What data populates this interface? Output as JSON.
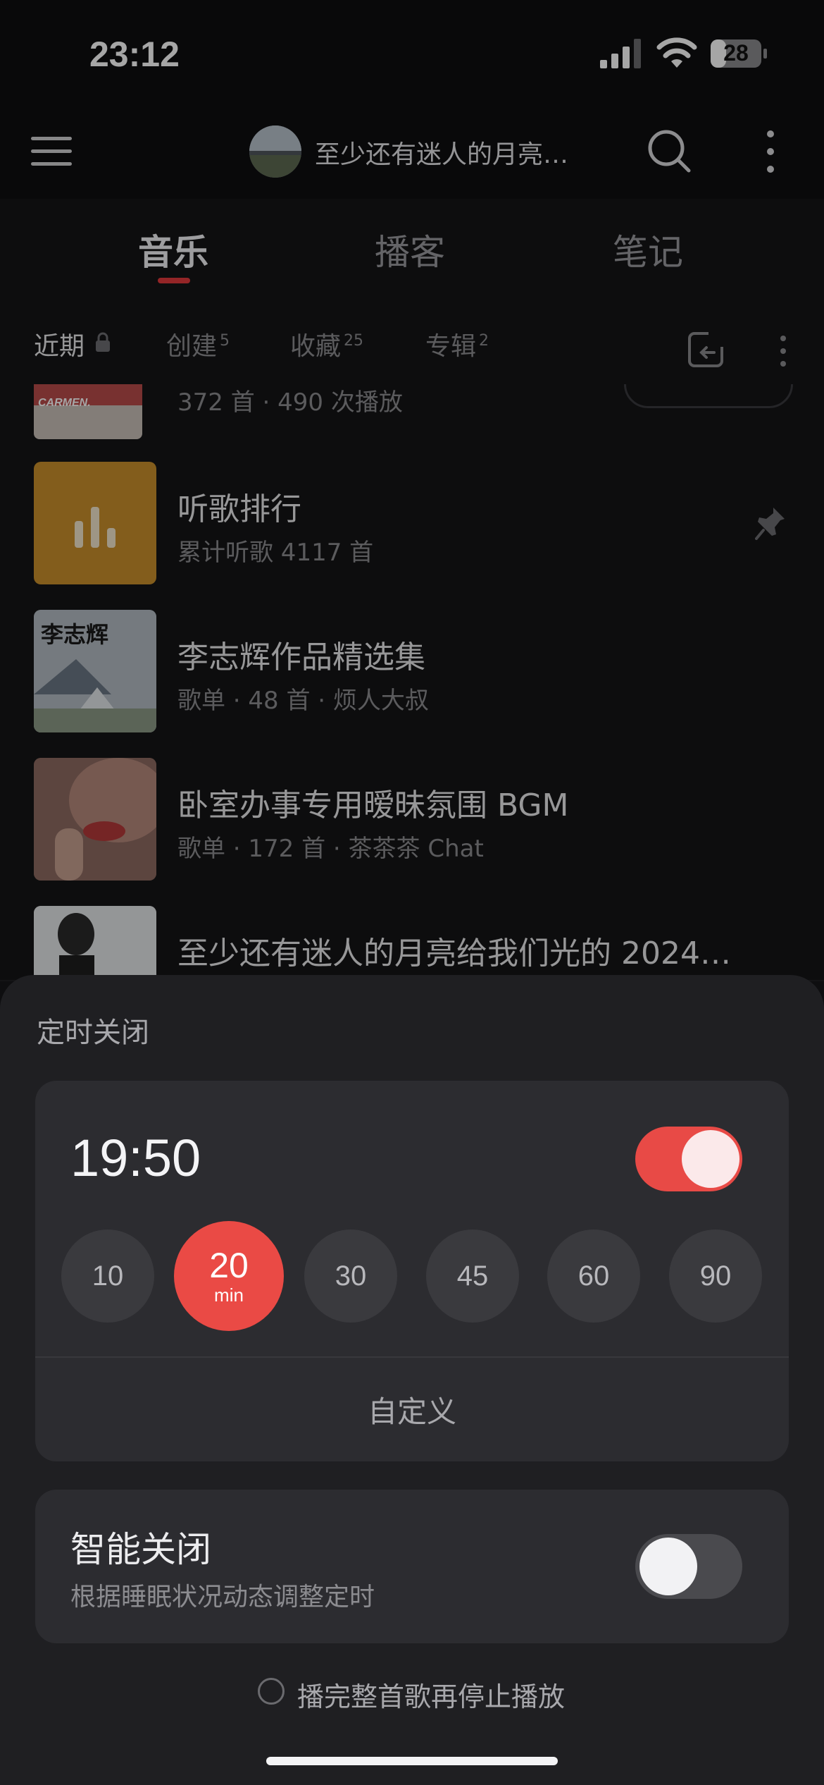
{
  "status_bar": {
    "time": "23:12",
    "battery": "28"
  },
  "header": {
    "title": "至少还有迷人的月亮…"
  },
  "main_tabs": [
    {
      "label": "音乐",
      "active": true
    },
    {
      "label": "播客",
      "active": false
    },
    {
      "label": "笔记",
      "active": false
    }
  ],
  "sub_tabs": [
    {
      "label": "近期",
      "count": ""
    },
    {
      "label": "创建",
      "count": "5"
    },
    {
      "label": "收藏",
      "count": "25"
    },
    {
      "label": "专辑",
      "count": "2"
    }
  ],
  "list": [
    {
      "title": "",
      "subtitle": "372 首 · 490 次播放",
      "thumb_text": "CARMEN."
    },
    {
      "title": "听歌排行",
      "subtitle": "累计听歌 4117 首",
      "pinned": true
    },
    {
      "title": "李志辉作品精选集",
      "subtitle": "歌单 · 48 首 · 烦人大叔",
      "thumb_text": "李志辉"
    },
    {
      "title": "卧室办事专用暧昧氛围 BGM",
      "subtitle": "歌单 · 172 首 · 茶茶茶 Chat"
    },
    {
      "title": "至少还有迷人的月亮给我们光的 2024…",
      "subtitle": ""
    }
  ],
  "sleep_timer": {
    "title": "定时关闭",
    "time": "19:50",
    "enabled": true,
    "options": [
      "10",
      "20",
      "30",
      "45",
      "60",
      "90"
    ],
    "selected": "20",
    "selected_unit": "min",
    "custom_label": "自定义"
  },
  "smart_close": {
    "title": "智能关闭",
    "description": "根据睡眠状况动态调整定时",
    "enabled": false
  },
  "finish_song": {
    "label": "播完整首歌再停止播放",
    "checked": false
  },
  "colors": {
    "accent": "#e84a46",
    "sheet": "#1f1f22",
    "card": "#2c2c30"
  }
}
